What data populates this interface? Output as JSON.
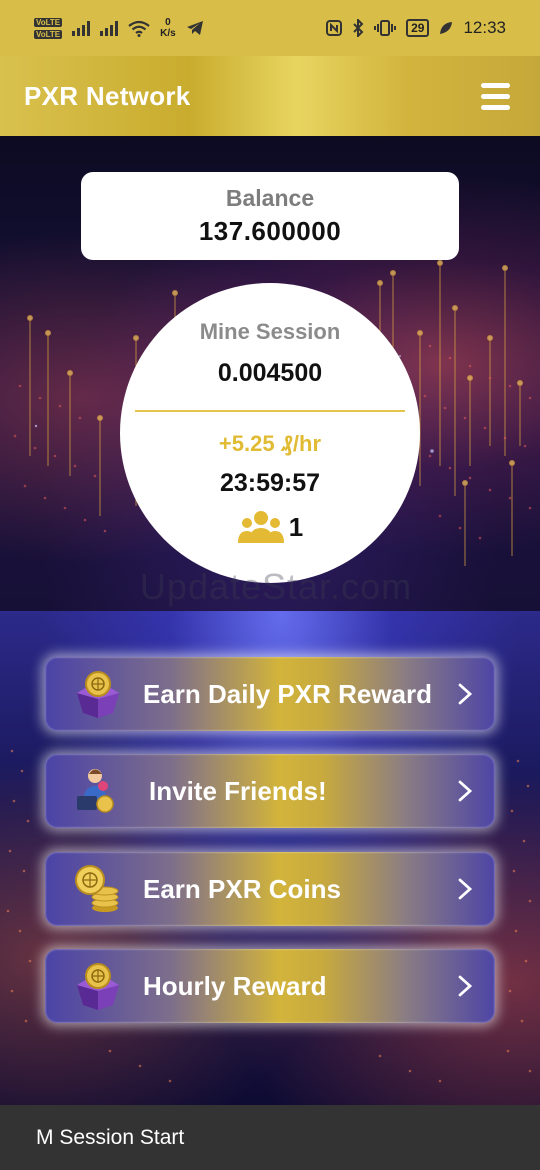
{
  "status_bar": {
    "network_speed": "0",
    "speed_unit": "K/s",
    "battery": "29",
    "time": "12:33"
  },
  "app_bar": {
    "title": "PXR Network"
  },
  "balance": {
    "label": "Balance",
    "value": "137.600000"
  },
  "mine_session": {
    "label": "Mine Session",
    "value": "0.004500",
    "rate": "+5.25 ₰/hr",
    "timer": "23:59:57",
    "team_count": "1"
  },
  "watermark": "UpdateStar.com",
  "actions": [
    {
      "label": "Earn Daily PXR Reward",
      "icon": "gift-box-icon"
    },
    {
      "label": "Invite Friends!",
      "icon": "invite-friends-icon"
    },
    {
      "label": "Earn PXR Coins",
      "icon": "coin-stack-icon"
    },
    {
      "label": "Hourly Reward",
      "icon": "gift-box-icon"
    }
  ],
  "snackbar": {
    "message": "M Session Start"
  },
  "colors": {
    "gold": "#d8be49",
    "accent_text": "#e0bb33",
    "dark_bg": "#0b0a2a",
    "button_purple": "#4b43a7"
  }
}
